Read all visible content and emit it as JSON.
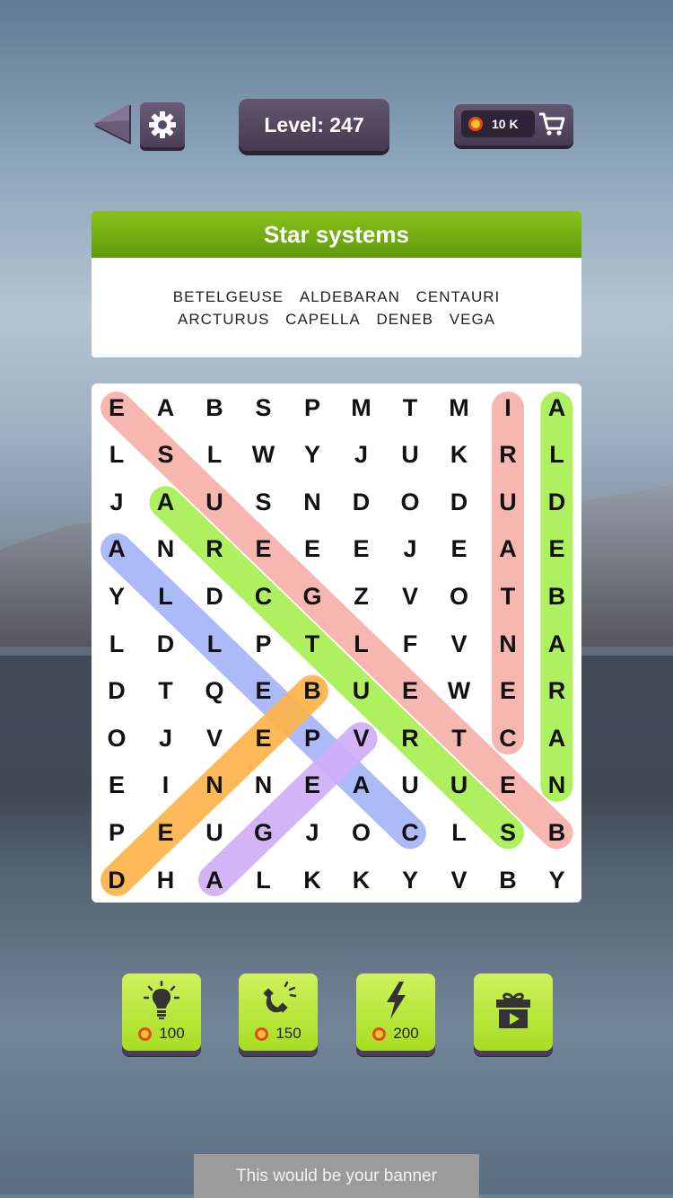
{
  "header": {
    "level_label": "Level: 247",
    "coins": "10 K"
  },
  "category": {
    "title": "Star systems",
    "words_row1": [
      "BETELGEUSE",
      "ALDEBARAN",
      "CENTAURI"
    ],
    "words_row2": [
      "ARCTURUS",
      "CAPELLA",
      "DENEB",
      "VEGA"
    ]
  },
  "grid": [
    [
      "E",
      "A",
      "B",
      "S",
      "P",
      "M",
      "T",
      "M",
      "I",
      "A"
    ],
    [
      "L",
      "S",
      "L",
      "W",
      "Y",
      "J",
      "U",
      "K",
      "R",
      "L"
    ],
    [
      "J",
      "A",
      "U",
      "S",
      "N",
      "D",
      "O",
      "D",
      "U",
      "D"
    ],
    [
      "A",
      "N",
      "R",
      "E",
      "E",
      "E",
      "J",
      "E",
      "A",
      "E"
    ],
    [
      "Y",
      "L",
      "D",
      "C",
      "G",
      "Z",
      "V",
      "O",
      "T",
      "B"
    ],
    [
      "L",
      "D",
      "L",
      "P",
      "T",
      "L",
      "F",
      "V",
      "N",
      "A"
    ],
    [
      "D",
      "T",
      "Q",
      "E",
      "B",
      "U",
      "E",
      "W",
      "E",
      "R"
    ],
    [
      "O",
      "J",
      "V",
      "E",
      "P",
      "V",
      "R",
      "T",
      "C",
      "A"
    ],
    [
      "E",
      "I",
      "N",
      "N",
      "E",
      "A",
      "U",
      "U",
      "E",
      "N"
    ],
    [
      "P",
      "E",
      "U",
      "G",
      "J",
      "O",
      "C",
      "L",
      "S",
      "B"
    ],
    [
      "D",
      "H",
      "A",
      "L",
      "K",
      "K",
      "Y",
      "V",
      "B",
      "Y"
    ]
  ],
  "found_words": [
    {
      "word": "BETELGEUSE",
      "from": [
        0,
        0
      ],
      "to": [
        9,
        9
      ],
      "color": "#f7b0aa"
    },
    {
      "word": "CENTAURI",
      "from": [
        8,
        0
      ],
      "to": [
        8,
        7
      ],
      "color": "#f7b0aa"
    },
    {
      "word": "ALDEBARAN",
      "from": [
        9,
        0
      ],
      "to": [
        9,
        8
      ],
      "color": "#a8ef52"
    },
    {
      "word": "ARCTURUS",
      "from": [
        1,
        2
      ],
      "to": [
        8,
        9
      ],
      "color": "#a8ef52"
    },
    {
      "word": "CAPELLA",
      "from": [
        6,
        9
      ],
      "to": [
        0,
        3
      ],
      "color": "#a6b6f7"
    },
    {
      "word": "DENEB",
      "from": [
        0,
        10
      ],
      "to": [
        4,
        6
      ],
      "color": "#fdb449"
    },
    {
      "word": "VEGA",
      "from": [
        5,
        7
      ],
      "to": [
        2,
        10
      ],
      "color": "#cfaef7"
    }
  ],
  "powerups": [
    {
      "name": "hint",
      "icon": "lightbulb-icon",
      "price": "100"
    },
    {
      "name": "magnet",
      "icon": "magnet-icon",
      "price": "150"
    },
    {
      "name": "lightning",
      "icon": "lightning-icon",
      "price": "200"
    },
    {
      "name": "gift-video",
      "icon": "gift-video-icon",
      "price": ""
    }
  ],
  "banner": "This would be your banner"
}
